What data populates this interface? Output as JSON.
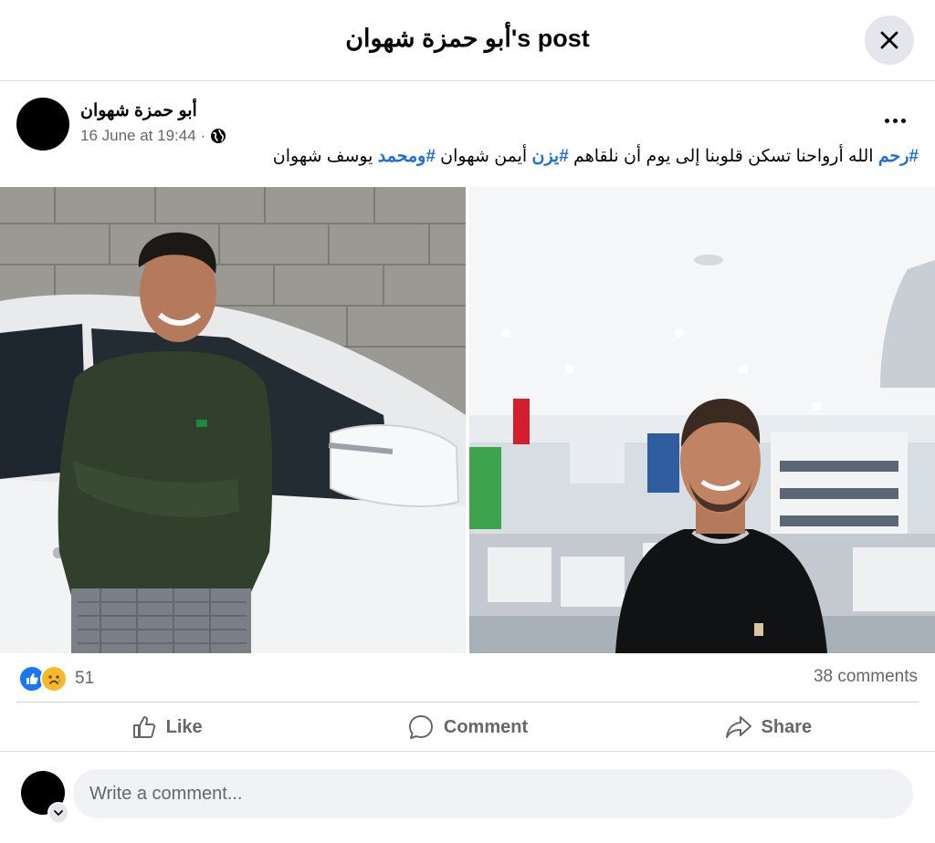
{
  "header": {
    "title": "أبو حمزة شهوان's post"
  },
  "post": {
    "author": "أبو حمزة شهوان",
    "timestamp": "16 June at 19:44",
    "separator": "·",
    "privacy_icon": "globe-icon",
    "caption_parts": [
      {
        "text": "#رحم",
        "tag": true
      },
      {
        "text": " الله أرواحنا تسكن قلوبنا إلى يوم أن نلقاهم ",
        "tag": false
      },
      {
        "text": "#يزن",
        "tag": true
      },
      {
        "text": " أيمن شهوان ",
        "tag": false
      },
      {
        "text": "#ومحمد",
        "tag": true
      },
      {
        "text": " يوسف شهوان",
        "tag": false
      }
    ]
  },
  "stats": {
    "reaction_count": "51",
    "comments_count": "38 comments",
    "reaction_icons": [
      "like-icon",
      "sad-icon"
    ]
  },
  "actions": {
    "like": "Like",
    "comment": "Comment",
    "share": "Share"
  },
  "comment_box": {
    "placeholder": "Write a comment..."
  },
  "colors": {
    "link": "#216fdb",
    "like_blue": "#1877f2",
    "sad_yellow": "#f7b928",
    "muted": "#65676b",
    "surface": "#f0f2f5"
  }
}
